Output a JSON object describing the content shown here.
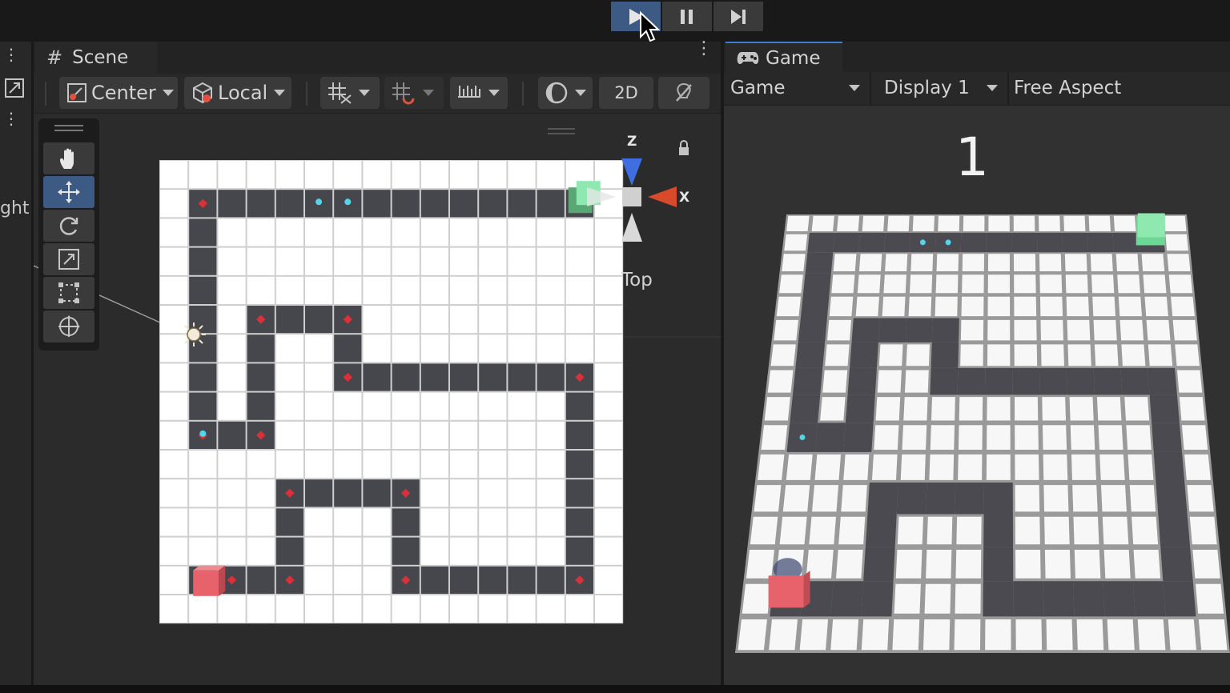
{
  "play_controls": {
    "play_icon": "play-icon",
    "pause_icon": "pause-icon",
    "step_icon": "step-icon",
    "play_active": true
  },
  "left_strip": {
    "label": "ght"
  },
  "scene": {
    "tab_label": "Scene",
    "toolbar": {
      "pivot_label": "Center",
      "space_label": "Local",
      "mode_2d_label": "2D"
    },
    "gizmo": {
      "axis_z": "Z",
      "axis_x": "X",
      "view_label": "Top"
    },
    "tools": [
      "hand-tool",
      "move-tool",
      "rotate-tool",
      "scale-tool",
      "rect-tool",
      "transform-tool"
    ],
    "active_tool": "move-tool",
    "maze": {
      "cols": 16,
      "rows": 16,
      "path": [
        [
          1,
          1
        ],
        [
          14,
          1
        ],
        [
          1,
          9
        ],
        [
          2,
          9
        ],
        [
          3,
          5
        ],
        [
          3,
          9
        ],
        [
          6,
          5
        ],
        [
          6,
          7
        ],
        [
          14,
          7
        ],
        [
          14,
          14
        ],
        [
          8,
          14
        ],
        [
          8,
          11
        ],
        [
          4,
          11
        ],
        [
          4,
          14
        ],
        [
          1,
          14
        ]
      ],
      "waypoints": [
        [
          1,
          1
        ],
        [
          1,
          9
        ],
        [
          3,
          9
        ],
        [
          3,
          5
        ],
        [
          6,
          5
        ],
        [
          6,
          7
        ],
        [
          14,
          7
        ],
        [
          14,
          14
        ],
        [
          8,
          14
        ],
        [
          8,
          11
        ],
        [
          4,
          11
        ],
        [
          4,
          14
        ],
        [
          2,
          14
        ]
      ],
      "gems": [
        [
          5,
          1
        ],
        [
          6,
          1
        ],
        [
          1,
          9
        ]
      ],
      "start_cube_color": "#e8626b",
      "goal_cube_color": "#8ee8b0",
      "path_color": "#46464d",
      "tile_color": "#ffffff",
      "waypoint_color": "#d9303a",
      "gem_color": "#4fd6ea"
    }
  },
  "game": {
    "tab_label": "Game",
    "display_select": "Game",
    "display_number": "Display 1",
    "aspect": "Free Aspect",
    "level_number": "1"
  }
}
